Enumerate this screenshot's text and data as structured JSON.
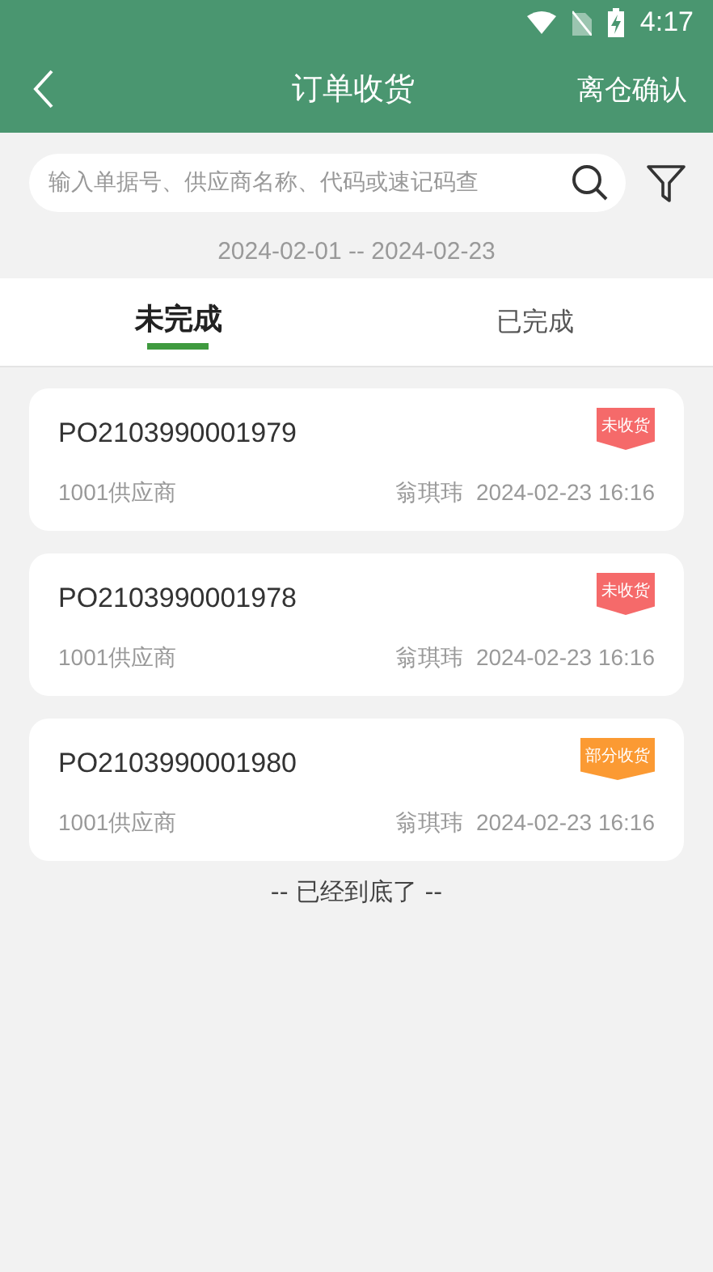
{
  "status_bar": {
    "time": "4:17"
  },
  "header": {
    "title": "订单收货",
    "action": "离仓确认"
  },
  "search": {
    "placeholder": "输入单据号、供应商名称、代码或速记码查"
  },
  "date_range": "2024-02-01 -- 2024-02-23",
  "tabs": [
    {
      "label": "未完成",
      "selected": true
    },
    {
      "label": "已完成",
      "selected": false
    }
  ],
  "orders": [
    {
      "number": "PO2103990001979",
      "supplier": "1001供应商",
      "person": "翁琪玮",
      "time": "2024-02-23 16:16",
      "status": "未收货",
      "color": "#f56a6a"
    },
    {
      "number": "PO2103990001978",
      "supplier": "1001供应商",
      "person": "翁琪玮",
      "time": "2024-02-23 16:16",
      "status": "未收货",
      "color": "#f56a6a"
    },
    {
      "number": "PO2103990001980",
      "supplier": "1001供应商",
      "person": "翁琪玮",
      "time": "2024-02-23 16:16",
      "status": "部分收货",
      "color": "#fb9a33"
    }
  ],
  "end_note": "-- 已经到底了 --"
}
